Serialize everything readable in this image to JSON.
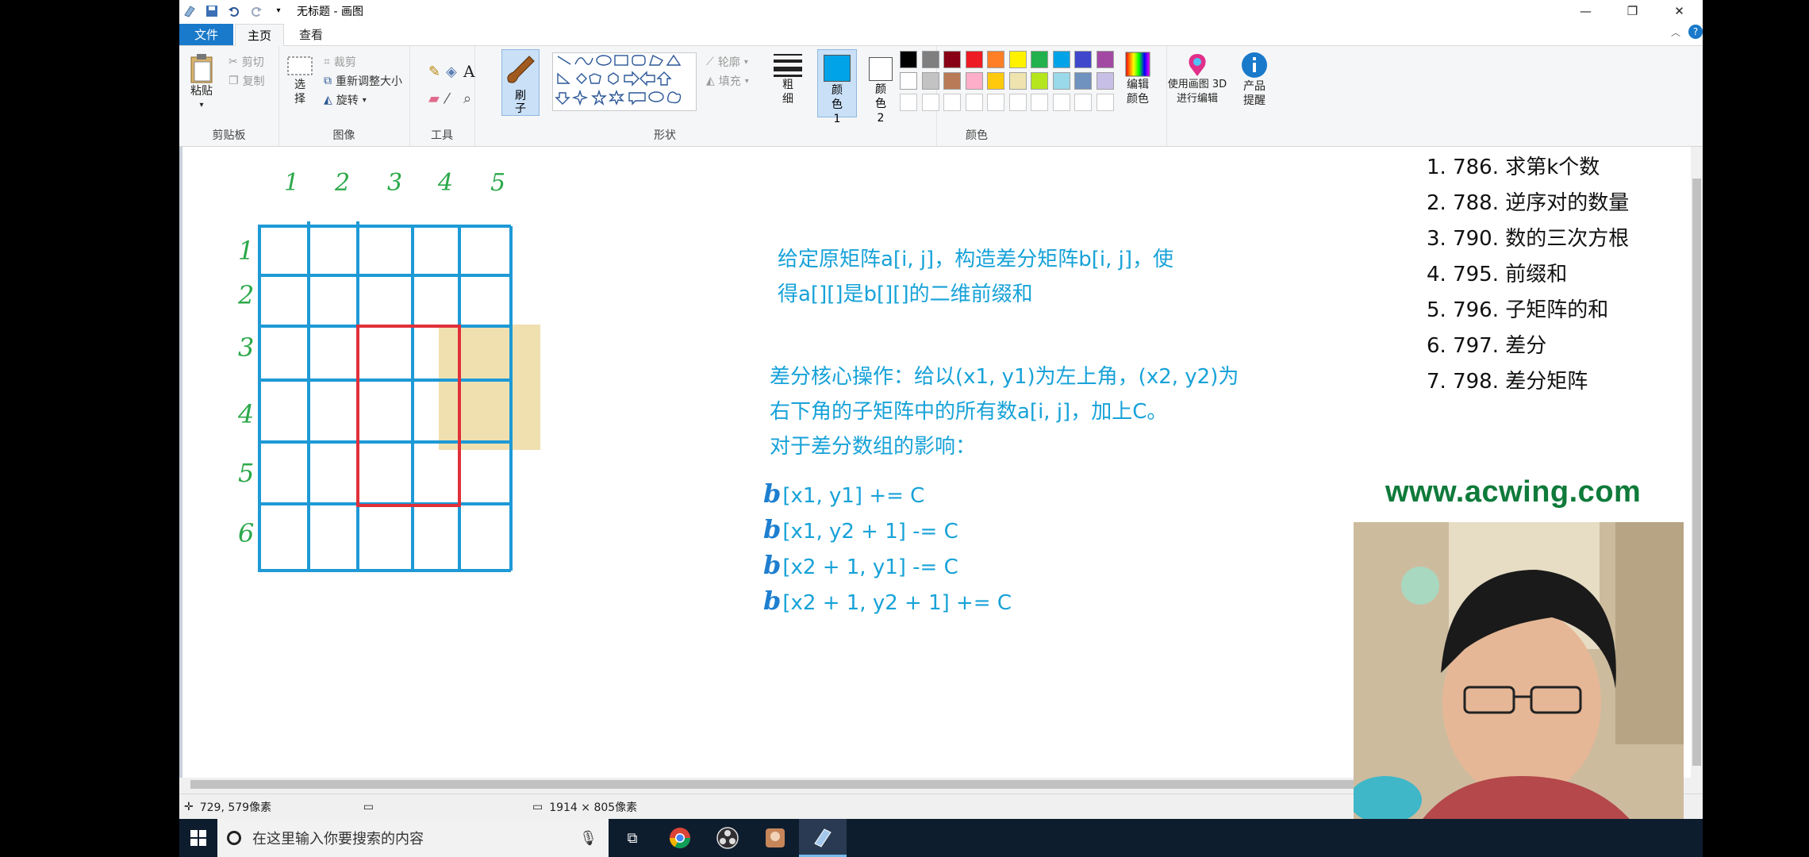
{
  "window": {
    "title": "无标题 - 画图"
  },
  "tabs": {
    "file": "文件",
    "home": "主页",
    "view": "查看"
  },
  "ribbon": {
    "clipboard": {
      "paste": "粘贴",
      "cut": "剪切",
      "copy": "复制",
      "label": "剪贴板"
    },
    "image": {
      "select": "选择",
      "crop": "裁剪",
      "resize": "重新调整大小",
      "rotate": "旋转",
      "label": "图像"
    },
    "tools": {
      "label": "工具"
    },
    "brush": {
      "label": "刷子"
    },
    "shapes": {
      "outline": "轮廓",
      "fill": "填充",
      "label": "形状"
    },
    "size": {
      "label": "粗细"
    },
    "color1": {
      "label": "颜色 1"
    },
    "color2": {
      "label": "颜色 2"
    },
    "colors": {
      "label": "颜色",
      "edit": "编辑颜色"
    },
    "paint3d": {
      "label": "使用画图 3D 进行编辑"
    },
    "alert": {
      "label": "产品提醒"
    }
  },
  "palette": [
    "#000000",
    "#7f7f7f",
    "#880015",
    "#ed1c24",
    "#ff7f27",
    "#fff200",
    "#22b14c",
    "#00a2e8",
    "#3f48cc",
    "#a349a4",
    "#ffffff",
    "#c3c3c3",
    "#b97a57",
    "#ffaec9",
    "#ffc90e",
    "#efe4b0",
    "#b5e61d",
    "#99d9ea",
    "#7092be",
    "#c8bfe7"
  ],
  "accent_color": "#1979ca",
  "canvas": {
    "col_labels": [
      "1",
      "2",
      "3",
      "4",
      "5"
    ],
    "row_labels": [
      "1",
      "2",
      "3",
      "4",
      "5",
      "6"
    ],
    "desc_lines": [
      "给定原矩阵a[i, j]，构造差分矩阵b[i, j]，使",
      "得a[][]是b[][]的二维前缀和"
    ],
    "op_lines": [
      "差分核心操作：给以(x1, y1)为左上角，(x2, y2)为",
      "右下角的子矩阵中的所有数a[i, j]，加上C。",
      "对于差分数组的影响："
    ],
    "formula_lines": [
      "[x1, y1] += C",
      "[x1, y2 + 1] -= C",
      "[x2 + 1, y1] -= C",
      "[x2 + 1, y2 + 1] += C"
    ],
    "formula_prefix": "b",
    "problems": [
      "1. 786. 求第k个数",
      "2. 788. 逆序对的数量",
      "3. 790. 数的三次方根",
      "4. 795. 前缀和",
      "5. 796. 子矩阵的和",
      "6. 797. 差分",
      "7. 798. 差分矩阵"
    ],
    "website": "www.acwing.com"
  },
  "status": {
    "cursor": "729, 579像素",
    "dimensions": "1914 × 805像素"
  },
  "taskbar": {
    "search_placeholder": "在这里输入你要搜索的内容"
  }
}
